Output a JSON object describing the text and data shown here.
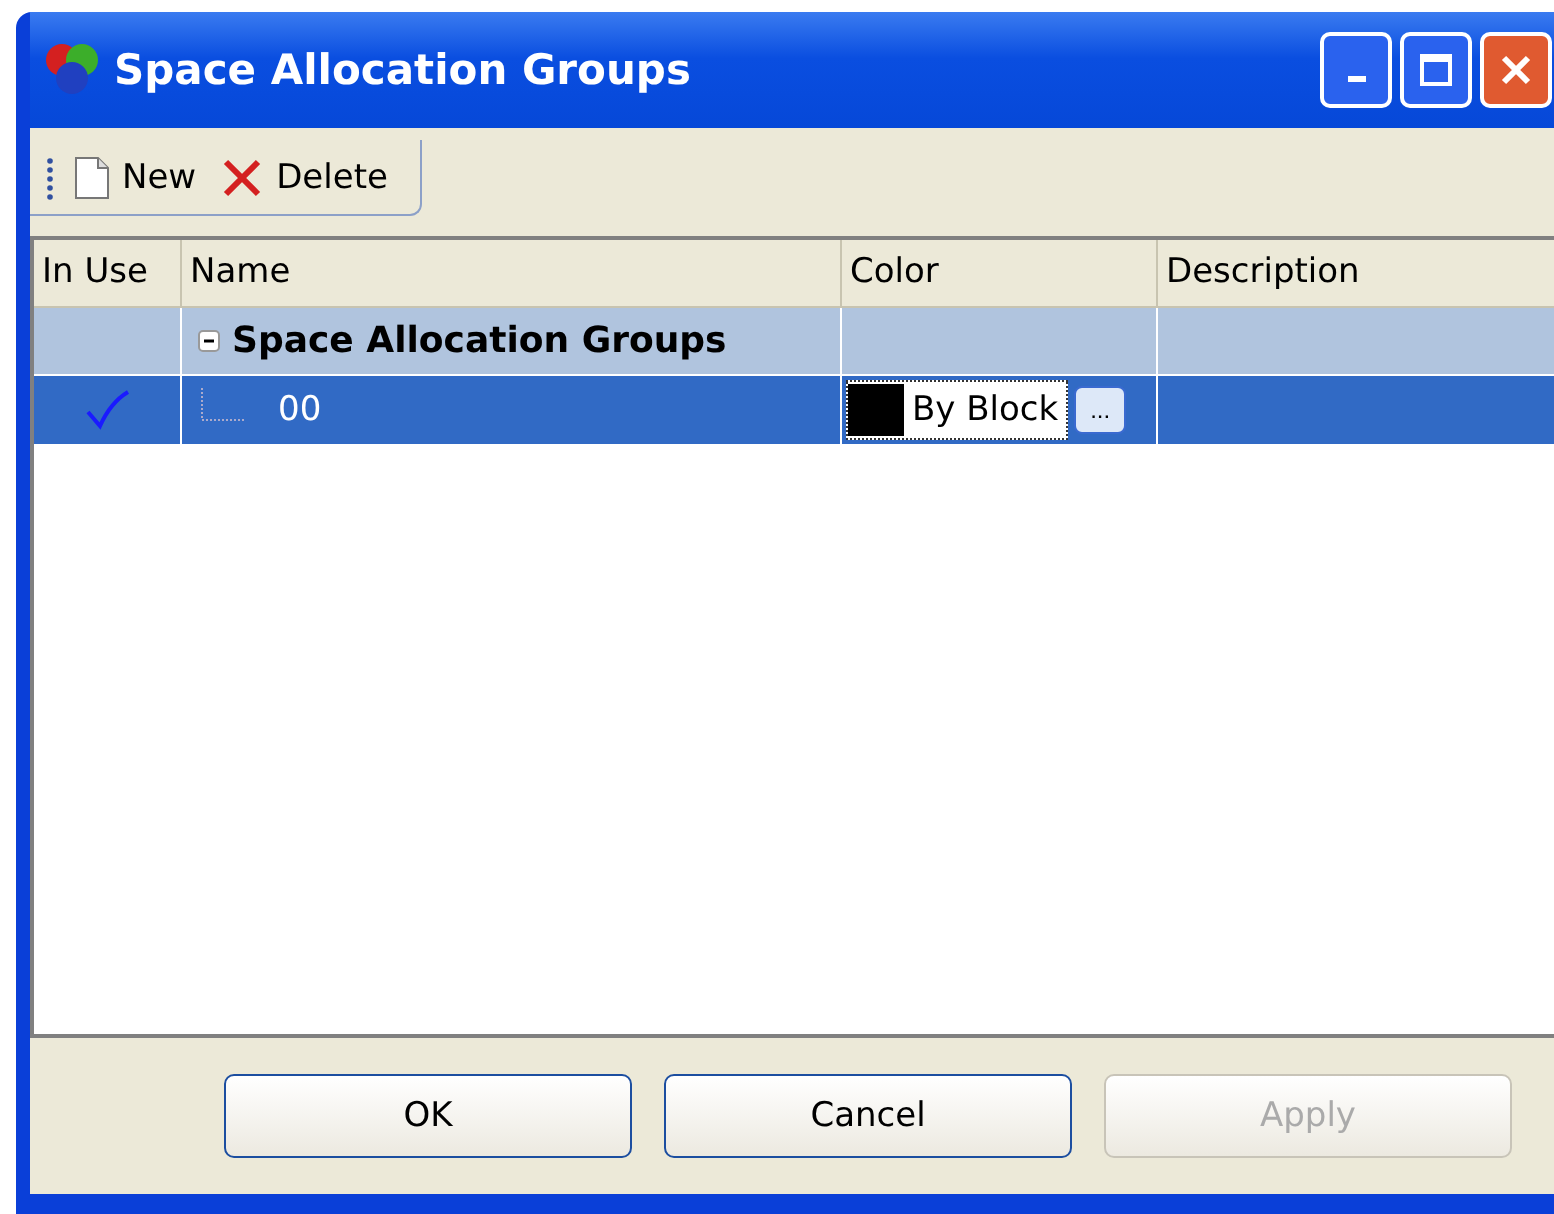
{
  "window": {
    "title": "Space Allocation Groups"
  },
  "toolbar": [
    {
      "kind": "new",
      "label": "New"
    },
    {
      "kind": "delete",
      "label": "Delete"
    }
  ],
  "table": {
    "columns": [
      "In Use",
      "Name",
      "Color",
      "Description"
    ],
    "group": {
      "name": "Space Allocation Groups",
      "expanded": true,
      "children": [
        {
          "in_use": true,
          "name": "00",
          "color_label": "By Block",
          "browse_label": "...",
          "selected": true
        }
      ]
    }
  },
  "buttons": [
    {
      "label": "OK",
      "disabled": false
    },
    {
      "label": "Cancel",
      "disabled": false
    },
    {
      "label": "Apply",
      "disabled": true
    }
  ]
}
